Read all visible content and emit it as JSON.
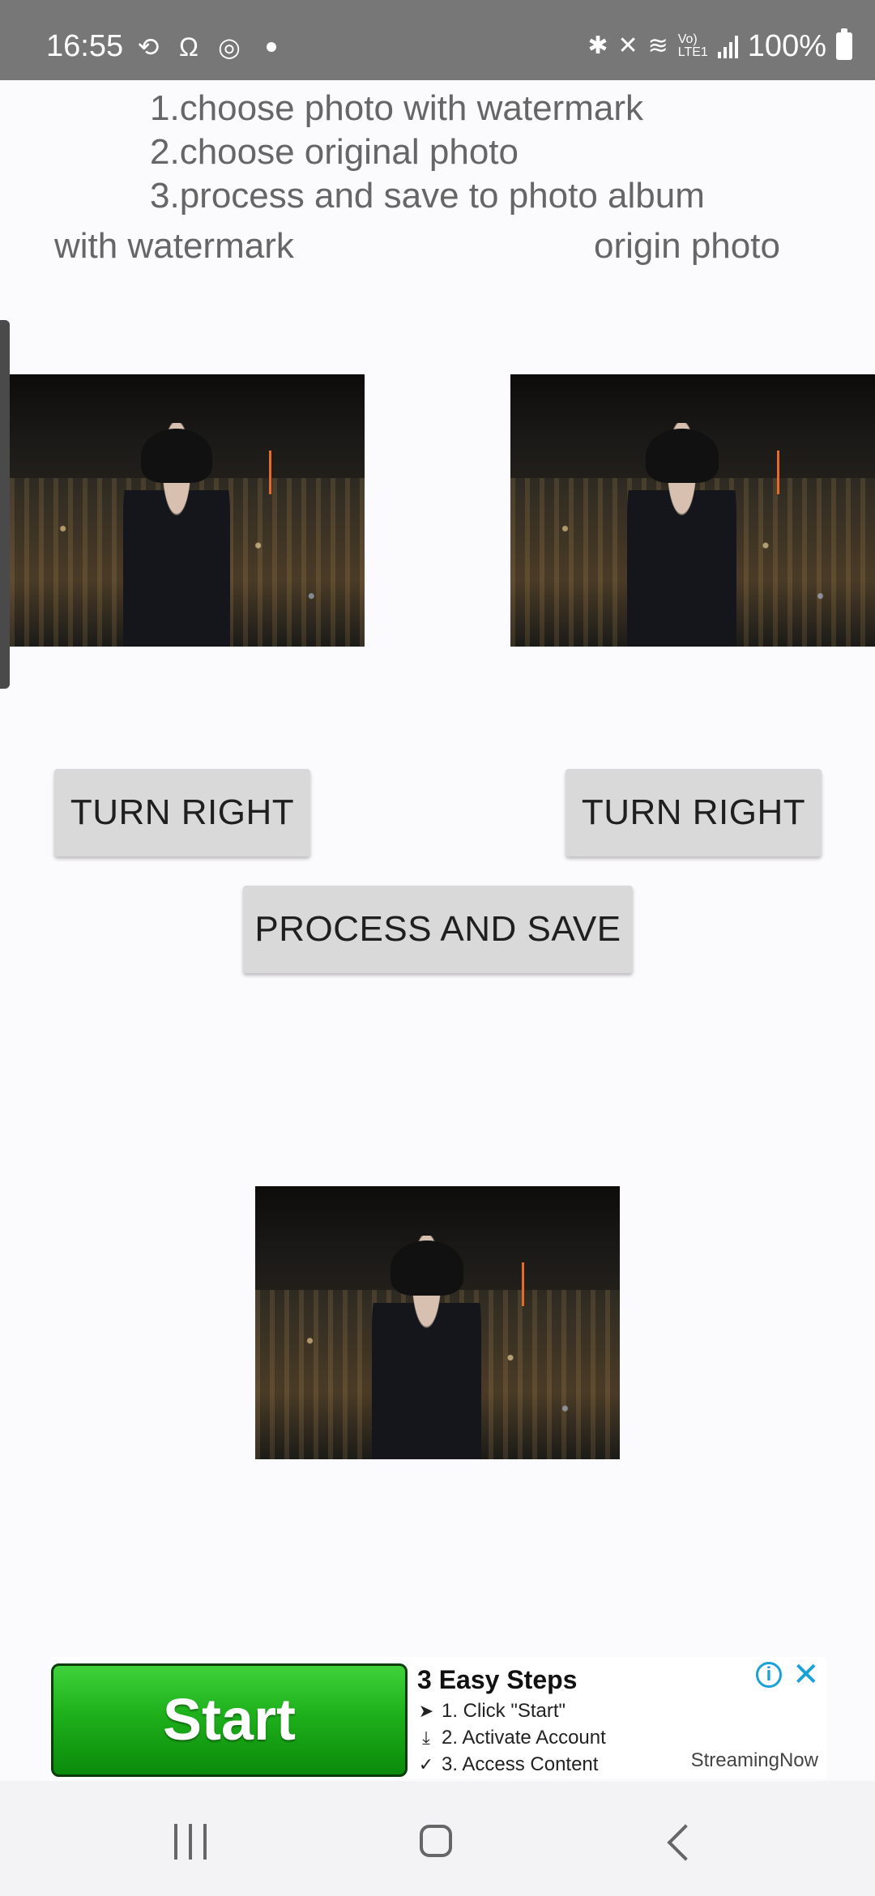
{
  "status_bar": {
    "time": "16:55",
    "battery": "100%",
    "left_icons": [
      "sync-icon",
      "alarm-icon",
      "instagram-icon",
      "dot-icon"
    ],
    "right_icons": [
      "bluetooth-icon",
      "mute-icon",
      "wifi-icon",
      "volte-icon",
      "signal-icon",
      "battery-icon"
    ]
  },
  "instructions": {
    "step1": "1.choose photo with watermark",
    "step2": "2.choose original photo",
    "step3": "3.process and save to photo album"
  },
  "labels": {
    "with_watermark": "with watermark",
    "origin_photo": "origin photo"
  },
  "buttons": {
    "turn_right_left": "TURN RIGHT",
    "turn_right_right": "TURN RIGHT",
    "process_and_save": "PROCESS AND SAVE"
  },
  "ad": {
    "start_label": "Start",
    "title": "3 Easy Steps",
    "steps": [
      "1. Click \"Start\"",
      "2. Activate Account",
      "3. Access Content"
    ],
    "brand": "StreamingNow",
    "accent_color": "#19a1d8",
    "button_color": "#1eb01b"
  },
  "navbar": {
    "icons": [
      "recents-icon",
      "home-icon",
      "back-icon"
    ]
  }
}
